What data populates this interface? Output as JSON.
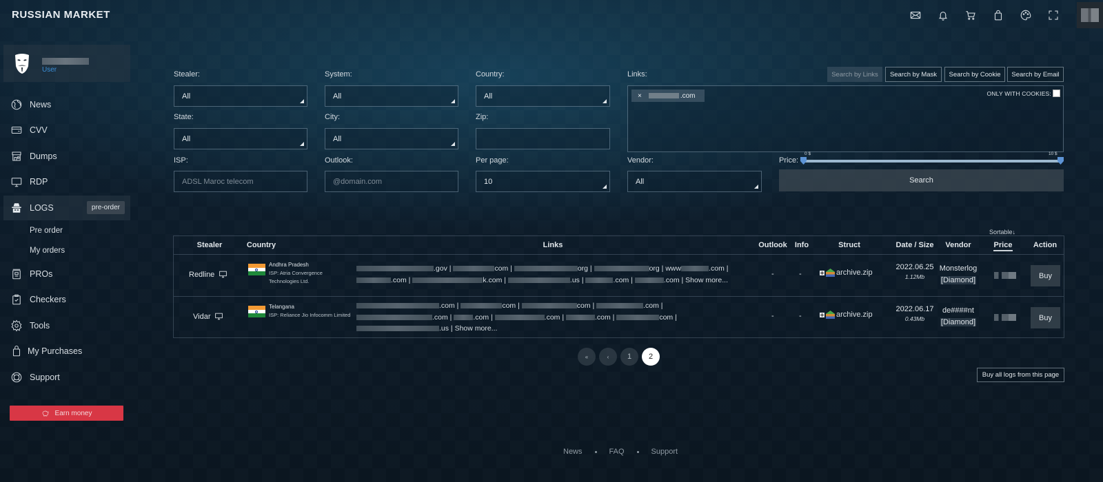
{
  "header": {
    "logo": "RUSSIAN MARKET",
    "icons": [
      "mail-icon",
      "bell-icon",
      "cart-icon",
      "shopping-bag-icon",
      "palette-icon",
      "fullscreen-icon"
    ]
  },
  "user": {
    "name_redacted": true,
    "role": "User"
  },
  "sidebar": {
    "items": [
      {
        "label": "News",
        "icon": "globe-icon"
      },
      {
        "label": "CVV",
        "icon": "credit-card-icon"
      },
      {
        "label": "Dumps",
        "icon": "store-icon"
      },
      {
        "label": "RDP",
        "icon": "monitor-icon"
      },
      {
        "label": "LOGS",
        "icon": "spy-icon",
        "badge": "pre-order",
        "active": true
      },
      {
        "label": "PROs",
        "icon": "pro-doc-icon"
      },
      {
        "label": "Checkers",
        "icon": "clipboard-check-icon"
      },
      {
        "label": "Tools",
        "icon": "gear-icon"
      },
      {
        "label": "My Purchases",
        "icon": "shopping-bag-icon"
      },
      {
        "label": "Support",
        "icon": "lifebuoy-icon"
      }
    ],
    "subitems": [
      "Pre order",
      "My orders"
    ],
    "earn_button": "Earn money"
  },
  "filters": {
    "stealer": {
      "label": "Stealer:",
      "value": "All"
    },
    "system": {
      "label": "System:",
      "value": "All"
    },
    "country": {
      "label": "Country:",
      "value": "All"
    },
    "state": {
      "label": "State:",
      "value": "All"
    },
    "city": {
      "label": "City:",
      "value": "All"
    },
    "zip": {
      "label": "Zip:",
      "value": ""
    },
    "isp": {
      "label": "ISP:",
      "placeholder": "ADSL Maroc telecom"
    },
    "outlook": {
      "label": "Outlook:",
      "placeholder": "@domain.com"
    },
    "per_page": {
      "label": "Per page:",
      "value": "10"
    },
    "vendor": {
      "label": "Vendor:",
      "value": "All"
    },
    "links": {
      "label": "Links:",
      "chip_remove": "×",
      "chip_suffix": ".com"
    },
    "only_with_cookies": {
      "label": "ONLY WITH COOKIES:",
      "checked": false
    },
    "search_tabs": [
      {
        "label": "Search by Links",
        "active": true
      },
      {
        "label": "Search by Mask",
        "active": false
      },
      {
        "label": "Search by Cookie",
        "active": false
      },
      {
        "label": "Search by Email",
        "active": false
      }
    ],
    "price": {
      "label": "Price:",
      "min_label": "0 $",
      "max_label": "10 $",
      "min": 0,
      "max": 10
    },
    "search_button": "Search"
  },
  "table": {
    "sortable_hint": "Sortable↓",
    "columns": [
      "Stealer",
      "Country",
      "Links",
      "Outlook",
      "Info",
      "Struct",
      "Date / Size",
      "Vendor",
      "Price",
      "Action"
    ],
    "rows": [
      {
        "stealer": "Redline",
        "region": "Andhra Pradesh",
        "isp": "ISP: Atria Convergence Technologies Ltd.",
        "links_visible": [
          ".gov |",
          "com |",
          "org |",
          "org | www",
          "com |",
          ".com |",
          "k.com |",
          ".us |",
          ".com |",
          ".com |"
        ],
        "show_more": "Show more...",
        "outlook": "-",
        "info": "-",
        "struct": "archive.zip",
        "date": "2022.06.25",
        "size": "1.12Mb",
        "vendor": "Monsterlog",
        "vendor_tier": "[Diamond]",
        "action": "Buy"
      },
      {
        "stealer": "Vidar",
        "region": "Telangana",
        "isp": "ISP: Reliance Jio Infocomm Limited",
        "links_visible": [
          ".com |",
          "com |",
          "com |",
          ".com |",
          ".com |",
          ".com |",
          ".com |",
          ".com |",
          "com |",
          ".us |"
        ],
        "show_more": "Show more...",
        "outlook": "-",
        "info": "-",
        "struct": "archive.zip",
        "date": "2022.06.17",
        "size": "0.43Mb",
        "vendor": "de####nt",
        "vendor_tier": "[Diamond]",
        "action": "Buy"
      }
    ]
  },
  "pagination": {
    "first": "«",
    "prev": "‹",
    "pages": [
      "1",
      "2"
    ],
    "current": "2"
  },
  "buy_all_button": "Buy all logs from this page",
  "footer": {
    "links": [
      "News",
      "FAQ",
      "Support"
    ]
  },
  "colors": {
    "accent_red": "#d83745",
    "role_blue": "#3b8fd9",
    "slider_blue": "#5d94d6"
  }
}
